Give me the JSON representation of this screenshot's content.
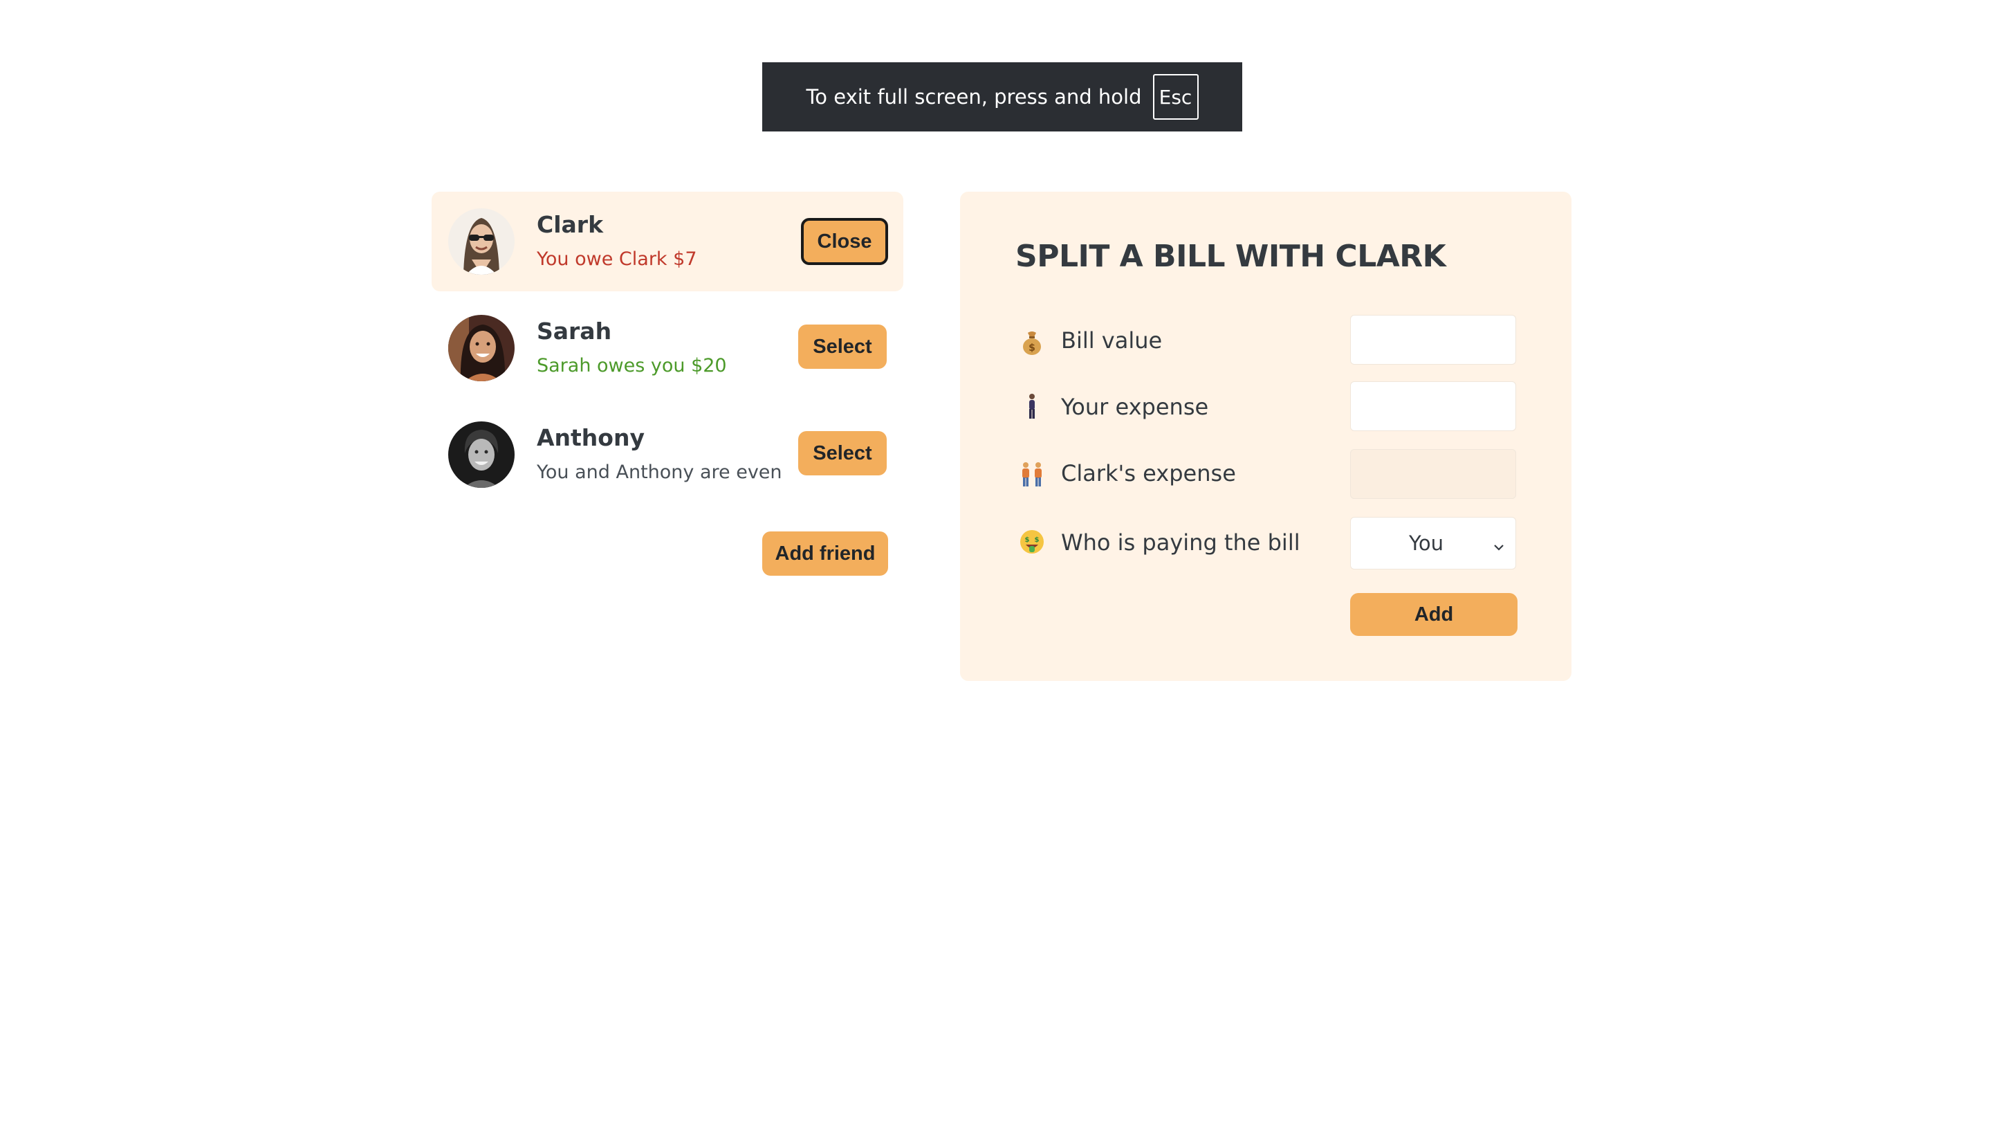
{
  "fullscreen_banner": {
    "text": "To exit full screen, press and hold",
    "key": "Esc"
  },
  "friends": [
    {
      "name": "Clark",
      "status": "You owe Clark $7",
      "status_type": "owe",
      "button": "Close",
      "selected": true
    },
    {
      "name": "Sarah",
      "status": "Sarah owes you $20",
      "status_type": "owed",
      "button": "Select",
      "selected": false
    },
    {
      "name": "Anthony",
      "status": "You and Anthony are even",
      "status_type": "even",
      "button": "Select",
      "selected": false
    }
  ],
  "add_friend_label": "Add friend",
  "split_form": {
    "title": "SPLIT A BILL WITH CLARK",
    "rows": [
      {
        "icon": "money-bag-icon",
        "label": "Bill value",
        "value": ""
      },
      {
        "icon": "person-standing-icon",
        "label": "Your expense",
        "value": ""
      },
      {
        "icon": "two-people-icon",
        "label": "Clark's expense",
        "value": ""
      },
      {
        "icon": "money-face-icon",
        "label": "Who is paying the bill",
        "value": "You"
      }
    ],
    "add_label": "Add"
  },
  "colors": {
    "accent": "#f3ae5c",
    "panel_bg": "#fff3e6",
    "owe": "#c0392b",
    "owed": "#4c9a2a",
    "banner_bg": "#2b2e33"
  }
}
